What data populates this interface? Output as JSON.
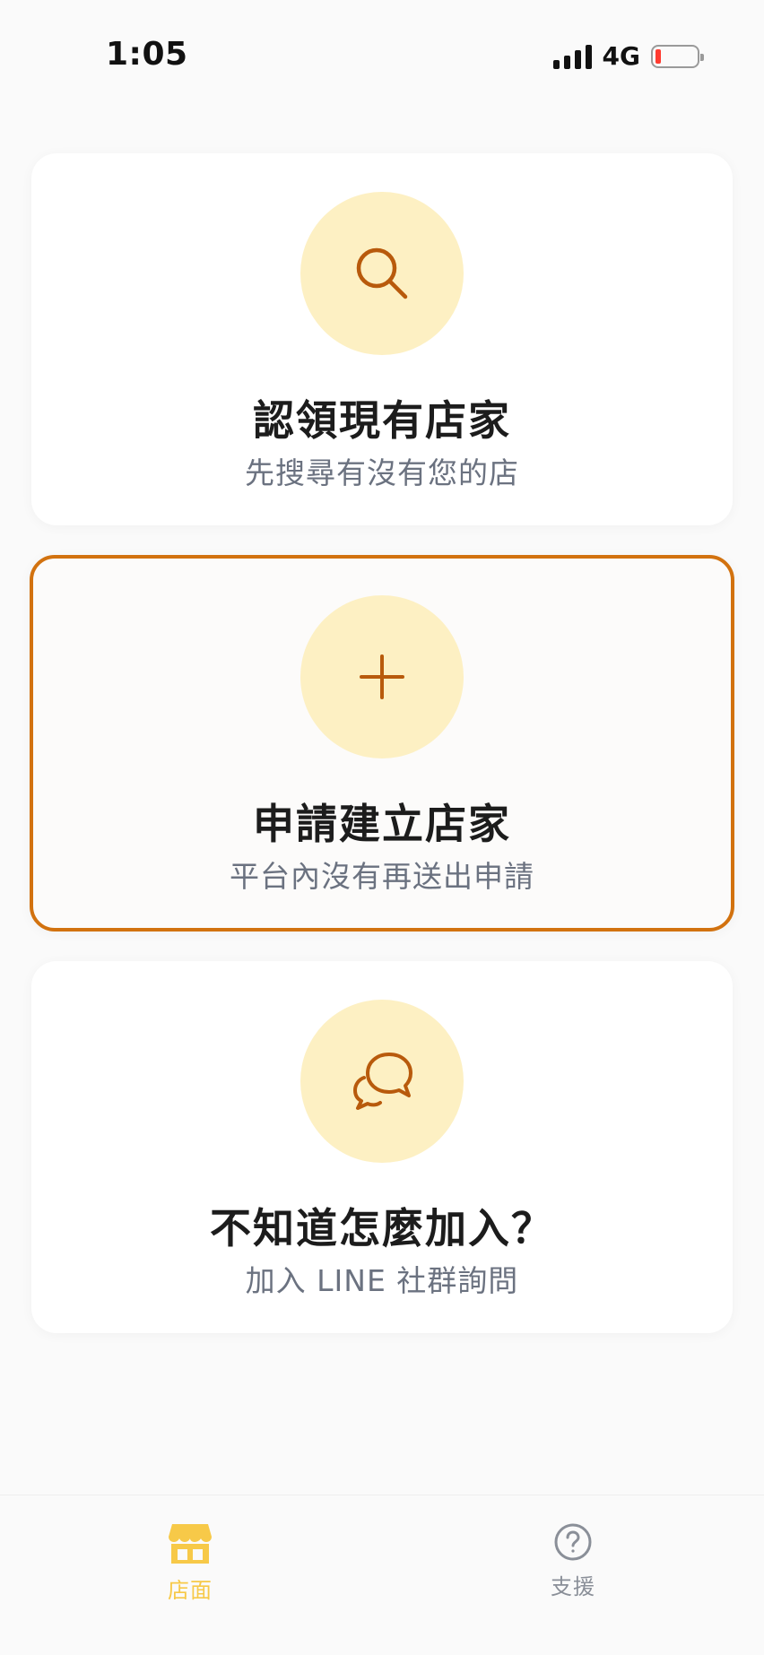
{
  "status_bar": {
    "time": "1:05",
    "network": "4G",
    "icons": [
      "signal-icon",
      "battery-low-icon"
    ]
  },
  "cards": [
    {
      "id": "claim",
      "icon": "search-icon",
      "title": "認領現有店家",
      "subtitle": "先搜尋有沒有您的店",
      "selected": false
    },
    {
      "id": "create",
      "icon": "plus-icon",
      "title": "申請建立店家",
      "subtitle": "平台內沒有再送出申請",
      "selected": true
    },
    {
      "id": "help",
      "icon": "chat-bubbles-icon",
      "title": "不知道怎麼加入？",
      "subtitle": "加入 LINE 社群詢問",
      "selected": false
    }
  ],
  "tab_bar": {
    "tabs": [
      {
        "label": "店面",
        "icon": "store-icon",
        "active": true
      },
      {
        "label": "支援",
        "icon": "help-circle-icon",
        "active": false
      }
    ]
  },
  "colors": {
    "accent": "#d2720f",
    "icon_stroke": "#b85a0c",
    "icon_circle": "#fdf0c3",
    "tab_active": "#f7c948",
    "tab_inactive": "#8a8f98",
    "battery_low": "#ff3b30"
  }
}
